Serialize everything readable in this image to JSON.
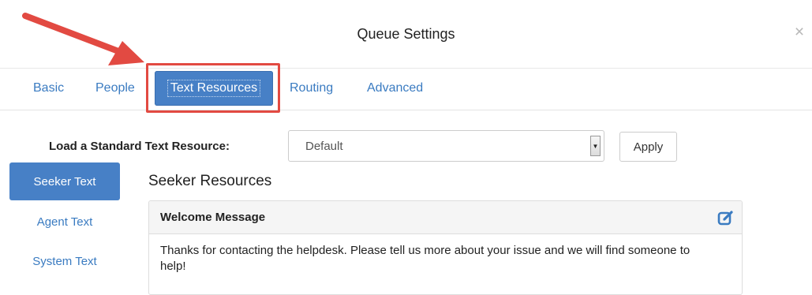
{
  "dialog": {
    "title": "Queue Settings",
    "close_symbol": "×"
  },
  "tabs": [
    {
      "label": "Basic",
      "active": false
    },
    {
      "label": "People",
      "active": false
    },
    {
      "label": "Text Resources",
      "active": true
    },
    {
      "label": "Routing",
      "active": false
    },
    {
      "label": "Advanced",
      "active": false
    }
  ],
  "load_standard": {
    "label": "Load a Standard Text Resource:",
    "selected": "Default",
    "apply_label": "Apply"
  },
  "sidebar": {
    "items": [
      {
        "label": "Seeker Text",
        "active": true
      },
      {
        "label": "Agent Text",
        "active": false
      },
      {
        "label": "System Text",
        "active": false
      }
    ]
  },
  "resources": {
    "section_title": "Seeker Resources",
    "panel": {
      "title": "Welcome Message",
      "body": "Thanks for contacting the helpdesk. Please tell us more about your issue and we will find someone to help!"
    }
  },
  "colors": {
    "accent": "#4780c6",
    "link": "#3a7bc1",
    "annotation": "#e24a42"
  },
  "icons": {
    "close": "close-icon",
    "edit": "edit-icon",
    "dropdown": "chevron-down-icon",
    "annotation": "arrow-annotation"
  }
}
